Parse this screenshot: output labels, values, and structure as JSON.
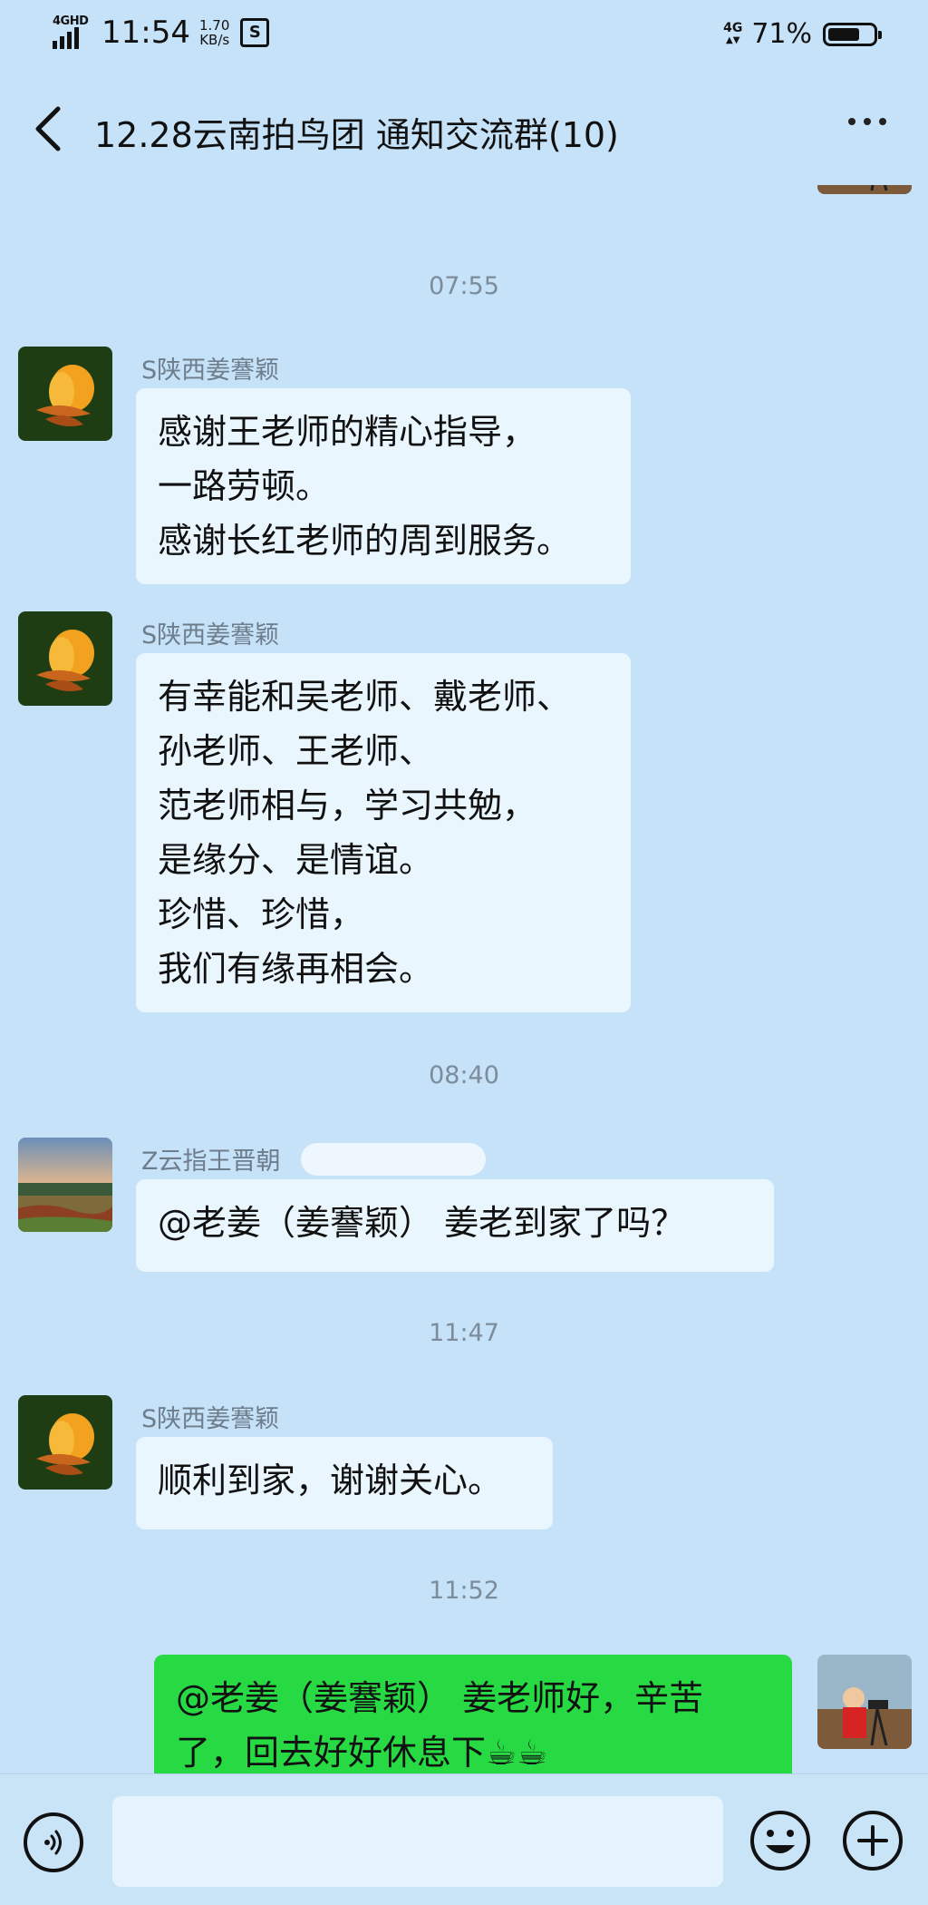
{
  "status_bar": {
    "network_left": "4GHD",
    "time": "11:54",
    "speed_value": "1.70",
    "speed_unit": "KB/s",
    "network_right": "4G",
    "battery_percent": "71%",
    "battery_level": 0.71
  },
  "header": {
    "title": "12.28云南拍鸟团 通知交流群(10)"
  },
  "messages": {
    "ts1": "07:55",
    "ts2": "08:40",
    "ts3": "11:47",
    "ts4": "11:52",
    "m1": {
      "sender": "S陕西姜謇颖",
      "text": "感谢王老师的精心指导，\n一路劳顿。\n感谢长红老师的周到服务。"
    },
    "m2": {
      "sender": "S陕西姜謇颖",
      "text": "有幸能和吴老师、戴老师、\n孙老师、王老师、\n范老师相与，学习共勉，\n是缘分、是情谊。\n珍惜、珍惜，\n我们有缘再相会。"
    },
    "m3": {
      "sender": "Z云指王晋朝",
      "text": "@老姜（姜謇颖）  姜老到家了吗？"
    },
    "m4": {
      "sender": "S陕西姜謇颖",
      "text": "顺利到家，谢谢关心。"
    },
    "m5": {
      "text": "@老姜（姜謇颖） 姜老师好，辛苦\n了，回去好好休息下☕☕"
    }
  },
  "input": {
    "value": "",
    "placeholder": ""
  },
  "icons": {
    "back": "chevron-left-icon",
    "more": "more-dots-icon",
    "voice": "voice-icon",
    "emoji": "emoji-icon",
    "plus": "plus-icon"
  },
  "colors": {
    "background": "#c6e2f8",
    "incoming_bubble": "#eaf6fe",
    "outgoing_bubble": "#27d942"
  }
}
